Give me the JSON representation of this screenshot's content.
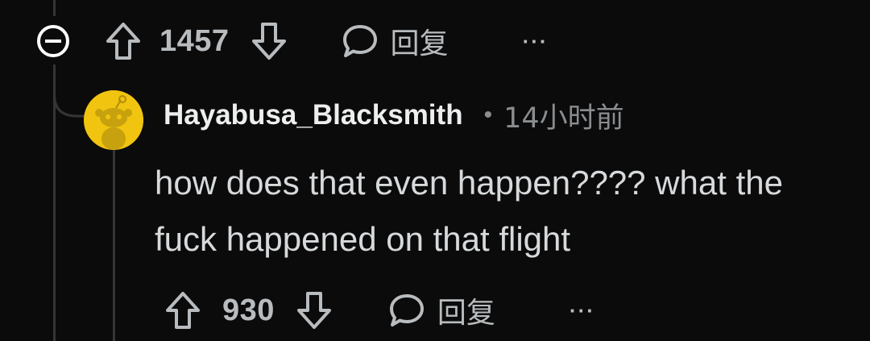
{
  "parent_actions": {
    "upvote_count": "1457",
    "reply_label": "回复",
    "more_label": "···"
  },
  "comment": {
    "username": "Hayabusa_Blacksmith",
    "separator": "•",
    "timestamp": "14小时前",
    "text": "how does that even happen???? what the fuck happened on that flight",
    "upvote_count": "930",
    "reply_label": "回复",
    "more_label": "···"
  },
  "colors": {
    "background": "#0b0b0b",
    "text_primary": "#d7dadc",
    "text_secondary": "#8a8d90",
    "avatar_bg": "#f1c40f",
    "thread_line": "#343536"
  },
  "icons": {
    "collapse": "minus-circle-icon",
    "upvote": "arrow-up-icon",
    "downvote": "arrow-down-icon",
    "reply": "speech-bubble-icon",
    "more": "ellipsis-icon"
  }
}
